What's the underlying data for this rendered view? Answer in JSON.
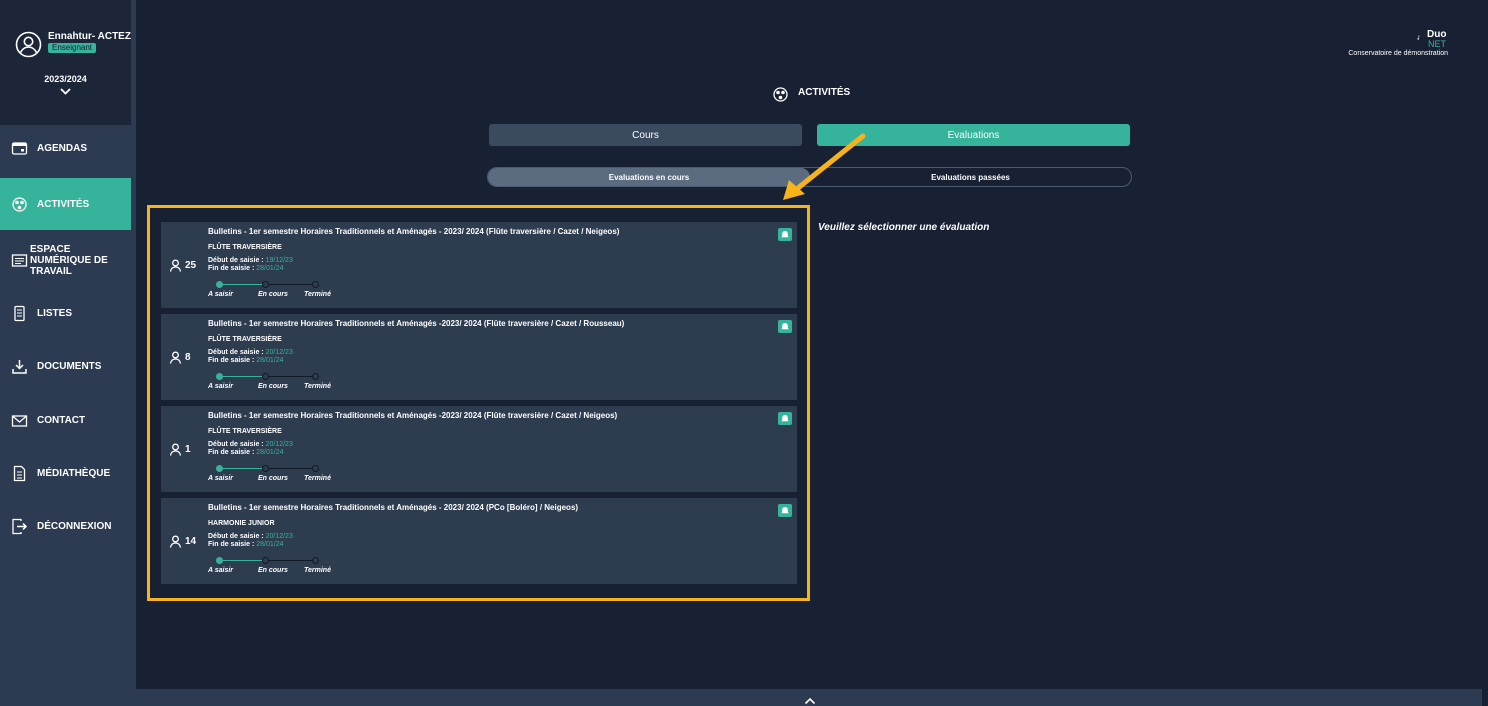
{
  "user": {
    "name": "Ennahtur- ACTEZ",
    "role": "Enseignant",
    "year": "2023/2024"
  },
  "nav": [
    {
      "label": "AGENDAS",
      "icon": "calendar-icon"
    },
    {
      "label": "ACTIVITÉS",
      "icon": "activities-icon"
    },
    {
      "label": "ESPACE NUMÉRIQUE DE TRAVAIL",
      "icon": "workspace-icon"
    },
    {
      "label": "LISTES",
      "icon": "list-icon"
    },
    {
      "label": "DOCUMENTS",
      "icon": "download-icon"
    },
    {
      "label": "CONTACT",
      "icon": "mail-icon"
    },
    {
      "label": "MÉDIATHÈQUE",
      "icon": "document-icon"
    },
    {
      "label": "DÉCONNEXION",
      "icon": "logout-icon"
    }
  ],
  "logo": {
    "duo": "Duo",
    "net": "NET",
    "subtitle": "Conservatoire de démonstration"
  },
  "page": {
    "title": "ACTIVITÉS"
  },
  "tabs": {
    "cours": "Cours",
    "evaluations": "Evaluations"
  },
  "subtabs": {
    "current": "Evaluations en cours",
    "past": "Evaluations passées"
  },
  "hint": "Veuillez sélectionner une évaluation",
  "labels": {
    "start": "Début de saisie :",
    "end": "Fin de saisie :",
    "step1": "A saisir",
    "step2": "En cours",
    "step3": "Terminé"
  },
  "evaluations": [
    {
      "title": "Bulletins - 1er semestre Horaires Traditionnels et Aménagés - 2023/ 2024 (Flûte traversière / Cazet / Neigeos)",
      "instrument": "FLÛTE TRAVERSIÈRE",
      "count": "25",
      "start": "19/12/23",
      "end": "28/01/24"
    },
    {
      "title": "Bulletins - 1er semestre Horaires Traditionnels et Aménagés -2023/ 2024 (Flûte traversière / Cazet / Rousseau)",
      "instrument": "FLÛTE TRAVERSIÈRE",
      "count": "8",
      "start": "20/12/23",
      "end": "28/01/24"
    },
    {
      "title": "Bulletins - 1er semestre Horaires Traditionnels et Aménagés -2023/ 2024 (Flûte traversière / Cazet / Neigeos)",
      "instrument": "FLÛTE TRAVERSIÈRE",
      "count": "1",
      "start": "20/12/23",
      "end": "28/01/24"
    },
    {
      "title": "Bulletins - 1er semestre Horaires Traditionnels et Aménagés - 2023/ 2024 (PCo [Boléro] / Neigeos)",
      "instrument": "HARMONIE JUNIOR",
      "count": "14",
      "start": "20/12/23",
      "end": "28/01/24"
    }
  ],
  "colors": {
    "accent": "#36b39b",
    "background": "#182033",
    "sidebar": "#2c3b51",
    "card": "#2e3c50",
    "highlight": "#f6b41a"
  }
}
